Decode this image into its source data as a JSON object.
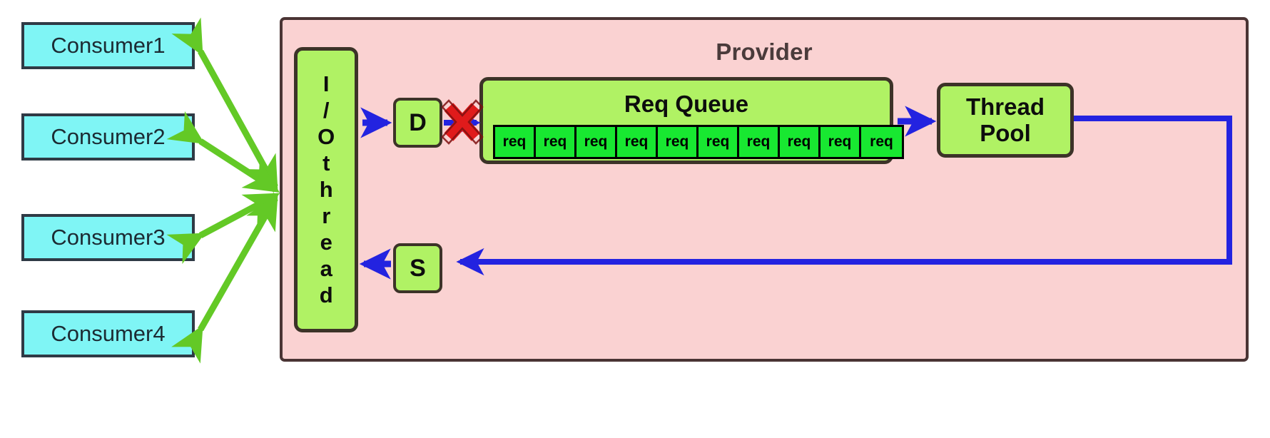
{
  "diagram": {
    "title_text": "Provider",
    "consumers": [
      {
        "label": "Consumer1"
      },
      {
        "label": "Consumer2"
      },
      {
        "label": "Consumer3"
      },
      {
        "label": "Consumer4"
      }
    ],
    "provider": {
      "label": "Provider",
      "io_thread": {
        "label": "I/Othread"
      },
      "dispatcher": {
        "label": "D"
      },
      "sender": {
        "label": "S"
      },
      "req_queue": {
        "label": "Req Queue",
        "cells": [
          {
            "label": "req"
          },
          {
            "label": "req"
          },
          {
            "label": "req"
          },
          {
            "label": "req"
          },
          {
            "label": "req"
          },
          {
            "label": "req"
          },
          {
            "label": "req"
          },
          {
            "label": "req"
          },
          {
            "label": "req"
          },
          {
            "label": "req"
          }
        ]
      },
      "thread_pool": {
        "label": "Thread\nPool",
        "line1": "Thread",
        "line2": "Pool"
      }
    },
    "markers": {
      "blocked_marker": "X"
    },
    "colors": {
      "consumer_fill": "#7ff5f5",
      "consumer_stroke": "#2f3a45",
      "provider_fill": "#fad2d2",
      "provider_stroke": "#4a3434",
      "node_fill": "#b0f264",
      "node_stroke": "#3c3328",
      "req_cell_fill": "#18e831",
      "green_arrow": "#63c926",
      "blue_arrow": "#2323e0",
      "red_x": "#e01b1b",
      "background": "#ffffff"
    }
  }
}
